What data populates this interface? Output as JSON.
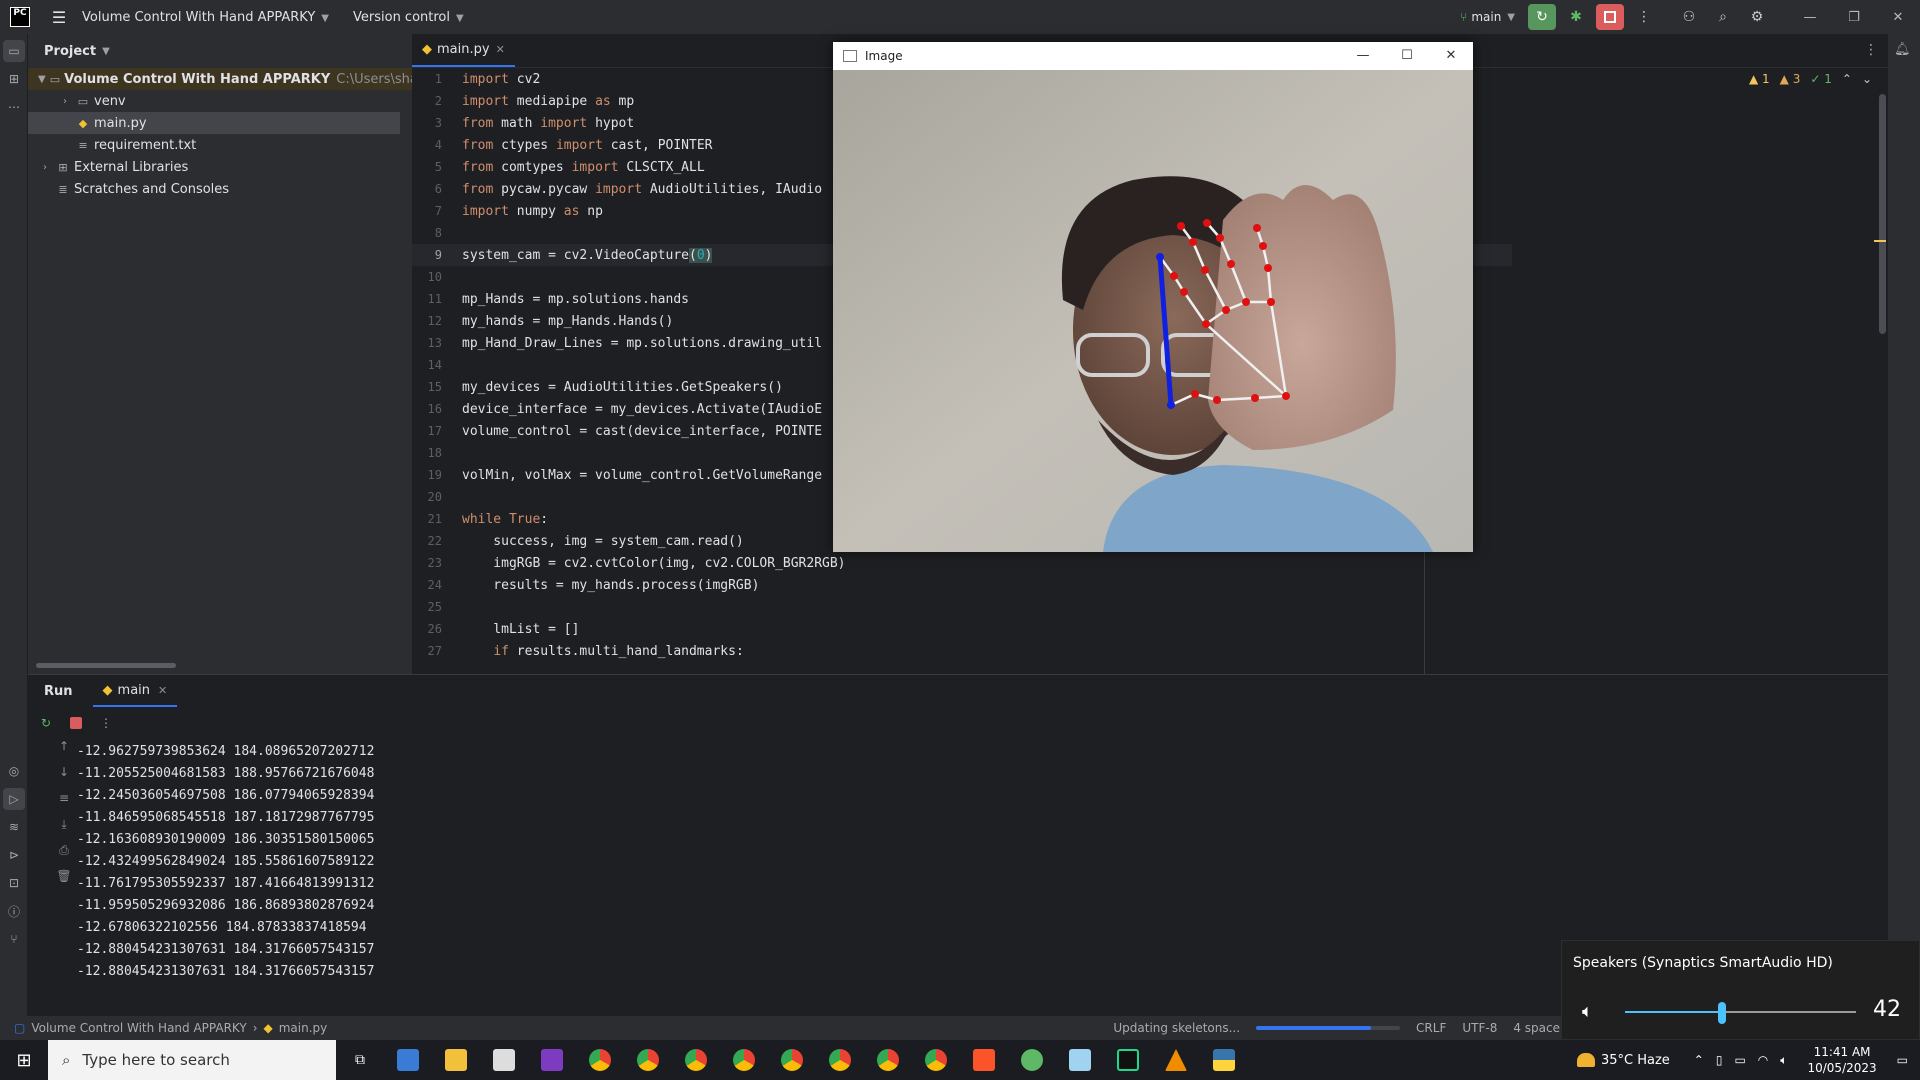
{
  "titlebar": {
    "logo": "PC",
    "project_name": "Volume Control With Hand APPARKY",
    "version_control": "Version control",
    "branch": "main"
  },
  "project_panel": {
    "title": "Project",
    "root": {
      "name": "Volume Control With Hand APPARKY",
      "path": "C:\\Users\\shad"
    },
    "items": [
      {
        "name": "venv",
        "type": "folder"
      },
      {
        "name": "main.py",
        "type": "python"
      },
      {
        "name": "requirement.txt",
        "type": "text"
      }
    ],
    "external": "External Libraries",
    "scratches": "Scratches and Consoles"
  },
  "editor": {
    "tab": "main.py",
    "inspections": {
      "warnings": "1",
      "weak_warnings": "3",
      "ok": "1"
    },
    "lines": [
      {
        "n": "1",
        "code": [
          [
            "kw",
            "import"
          ],
          [
            "t",
            " cv2"
          ]
        ]
      },
      {
        "n": "2",
        "code": [
          [
            "kw",
            "import"
          ],
          [
            "t",
            " mediapipe "
          ],
          [
            "kw",
            "as"
          ],
          [
            "t",
            " mp"
          ]
        ]
      },
      {
        "n": "3",
        "code": [
          [
            "kw",
            "from"
          ],
          [
            "t",
            " math "
          ],
          [
            "kw",
            "import"
          ],
          [
            "t",
            " hypot"
          ]
        ]
      },
      {
        "n": "4",
        "code": [
          [
            "kw",
            "from"
          ],
          [
            "t",
            " ctypes "
          ],
          [
            "kw",
            "import"
          ],
          [
            "t",
            " cast, POINTER"
          ]
        ]
      },
      {
        "n": "5",
        "code": [
          [
            "kw",
            "from"
          ],
          [
            "t",
            " comtypes "
          ],
          [
            "kw",
            "import"
          ],
          [
            "t",
            " CLSCTX_ALL"
          ]
        ]
      },
      {
        "n": "6",
        "code": [
          [
            "kw",
            "from"
          ],
          [
            "t",
            " pycaw.pycaw "
          ],
          [
            "kw",
            "import"
          ],
          [
            "t",
            " AudioUtilities, IAudio"
          ]
        ]
      },
      {
        "n": "7",
        "code": [
          [
            "kw",
            "import"
          ],
          [
            "t",
            " numpy "
          ],
          [
            "kw",
            "as"
          ],
          [
            "t",
            " np"
          ]
        ]
      },
      {
        "n": "8",
        "code": []
      },
      {
        "n": "9",
        "code": [
          [
            "t",
            "system_cam = cv2.VideoCapture"
          ],
          [
            "hl",
            "("
          ],
          [
            "num",
            "0"
          ],
          [
            "hl",
            ")"
          ]
        ],
        "current": true
      },
      {
        "n": "10",
        "code": []
      },
      {
        "n": "11",
        "code": [
          [
            "t",
            "mp_Hands = mp.solutions.hands"
          ]
        ]
      },
      {
        "n": "12",
        "code": [
          [
            "t",
            "my_hands = mp_Hands.Hands()"
          ]
        ]
      },
      {
        "n": "13",
        "code": [
          [
            "t",
            "mp_Hand_Draw_Lines = mp.solutions.drawing_util"
          ]
        ]
      },
      {
        "n": "14",
        "code": []
      },
      {
        "n": "15",
        "code": [
          [
            "t",
            "my_devices = AudioUtilities.GetSpeakers()"
          ]
        ]
      },
      {
        "n": "16",
        "code": [
          [
            "t",
            "device_interface = my_devices.Activate(IAudioE"
          ]
        ]
      },
      {
        "n": "17",
        "code": [
          [
            "t",
            "volume_control = cast(device_interface, POINTE"
          ]
        ]
      },
      {
        "n": "18",
        "code": []
      },
      {
        "n": "19",
        "code": [
          [
            "t",
            "volMin, volMax = volume_control.GetVolumeRange"
          ]
        ]
      },
      {
        "n": "20",
        "code": []
      },
      {
        "n": "21",
        "code": [
          [
            "kw",
            "while"
          ],
          [
            "t",
            " "
          ],
          [
            "kw",
            "True"
          ],
          [
            "t",
            ":"
          ]
        ]
      },
      {
        "n": "22",
        "code": [
          [
            "t",
            "    success, img = system_cam.read()"
          ]
        ]
      },
      {
        "n": "23",
        "code": [
          [
            "t",
            "    imgRGB = cv2.cvtColor(img, cv2.COLOR_BGR2RGB)"
          ]
        ]
      },
      {
        "n": "24",
        "code": [
          [
            "t",
            "    results = my_hands.process(imgRGB)"
          ]
        ]
      },
      {
        "n": "25",
        "code": []
      },
      {
        "n": "26",
        "code": [
          [
            "t",
            "    lmList = []"
          ]
        ]
      },
      {
        "n": "27",
        "code": [
          [
            "t",
            "    "
          ],
          [
            "kw",
            "if"
          ],
          [
            "t",
            " results.multi_hand_landmarks:"
          ]
        ]
      }
    ]
  },
  "image_window": {
    "title": "Image"
  },
  "run": {
    "title": "Run",
    "tab": "main",
    "output": [
      "-12.962759739853624 184.08965207202712",
      "-11.205525004681583 188.95766721676048",
      "-12.245036054697508 186.07794065928394",
      "-11.846595068545518 187.18172987767795",
      "-12.163608930190009 186.30351580150065",
      "-12.432499562849024 185.55861607589122",
      "-11.761795305592337 187.41664813991312",
      "-11.959505296932086 186.86893802876924",
      "-12.67806322102556 184.87833837418594",
      "-12.880454231307631 184.31766057543157",
      "-12.880454231307631 184.31766057543157"
    ]
  },
  "statusbar": {
    "project": "Volume Control With Hand APPARKY",
    "file": "main.py",
    "task": "Updating skeletons...",
    "task_progress": 0.8,
    "line_ending": "CRLF",
    "encoding": "UTF-8",
    "indent": "4 space"
  },
  "volume_flyout": {
    "device": "Speakers (Synaptics SmartAudio HD)",
    "level": 42,
    "level_fraction": 0.42
  },
  "taskbar": {
    "search_placeholder": "Type here to search",
    "weather": "35°C  Haze",
    "time": "11:41 AM",
    "date": "10/05/2023"
  },
  "colors": {
    "accent": "#3574f0",
    "keyword": "#cf8e6d",
    "number": "#2aacb8",
    "volume_accent": "#4cc2ff"
  }
}
